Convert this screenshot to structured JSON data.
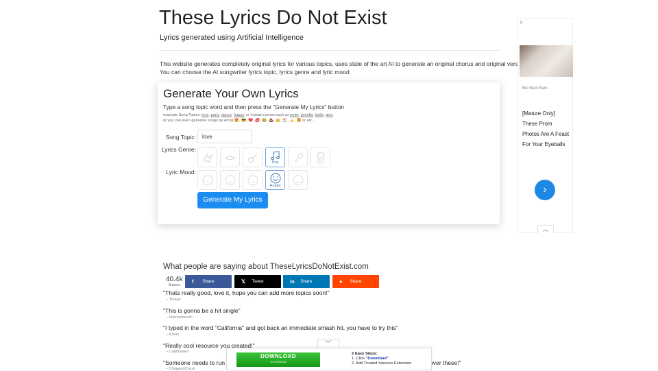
{
  "header": {
    "title": "These Lyrics Do Not Exist",
    "subtitle": "Lyrics generated using Artificial Intelligence"
  },
  "intro": {
    "line1": "This website generates completely original lyrics for various topics, uses state of the art AI to generate an original chorus and original verses",
    "line2": "You can choose the AI songwriter lyrics topic, lyrics genre and lyric mood"
  },
  "generator": {
    "title": "Generate Your Own Lyrics",
    "instruction": "Type a song topic word and then press the \"Generate My Lyrics\" button",
    "examples_prefix": "example Song Topics:",
    "example_topics": [
      "love",
      "party",
      "dance",
      "happy"
    ],
    "names_prefix": ", or human names such as",
    "example_names": [
      "peter",
      "jennifer",
      "bella",
      "alex"
    ],
    "emoji_prefix": "or you can even generate songs by emoji",
    "emojis": "🤩, 😎, ❤️, 💋, 😂, 💩, 👑, 🏖️, 🍌, 🍔",
    "emoji_suffix": "or etc...",
    "topic_label": "Song Topic:",
    "topic_value": "love",
    "genre_label": "Lyrics Genre:",
    "genres": [
      {
        "icon": "rock-icon",
        "label": "",
        "selected": false
      },
      {
        "icon": "country-icon",
        "label": "",
        "selected": false
      },
      {
        "icon": "guitar-icon",
        "label": "",
        "selected": false
      },
      {
        "icon": "music-note-icon",
        "label": "Pop",
        "selected": true
      },
      {
        "icon": "microphone-icon",
        "label": "",
        "selected": false
      },
      {
        "icon": "metal-icon",
        "label": "",
        "selected": false
      }
    ],
    "mood_label": "Lyric Mood:",
    "moods": [
      {
        "icon": "angry-face-icon",
        "label": "",
        "selected": false
      },
      {
        "icon": "sad-face-icon",
        "label": "",
        "selected": false
      },
      {
        "icon": "neutral-face-icon",
        "label": "",
        "selected": false
      },
      {
        "icon": "happy-face-icon",
        "label": "Happy",
        "selected": true
      },
      {
        "icon": "love-face-icon",
        "label": "",
        "selected": false
      }
    ],
    "button_label": "Generate My Lyrics"
  },
  "ad": {
    "source": "Bio Bam Bam",
    "lines": [
      "[Mature Only]",
      "These Prom",
      "Photos Are A Feast",
      "For Your Eyeballs"
    ]
  },
  "testimonials": {
    "title": "What people are saying about TheseLyricsDoNotExist.com",
    "share_count": "40.4k",
    "share_label": "Shares",
    "share_buttons": [
      {
        "name": "facebook",
        "icon": "f",
        "label": "Share",
        "color": "#3b5998"
      },
      {
        "name": "twitter",
        "icon": "𝕏",
        "label": "Tweet",
        "color": "#000000"
      },
      {
        "name": "linkedin",
        "icon": "in",
        "label": "Share",
        "color": "#0077b5"
      },
      {
        "name": "reddit",
        "icon": "●",
        "label": "Share",
        "color": "#ff4500"
      }
    ],
    "quotes": [
      {
        "text": "\"Thats really good, love it, hope you can add more topics soon!\"",
        "author": "– Thiago"
      },
      {
        "text": "\"This is gonna be a hit single\"",
        "author": "– Internetmoshi"
      },
      {
        "text": "\"I typed in the word \"California\" and got back an immediate smash hit, you have to try this\"",
        "author": "– Ethan"
      },
      {
        "text": "\"Really cool resource you created!\"",
        "author": "– CaliBrewed"
      },
      {
        "text": "\"Someone needs to run th",
        "text_end": "over these!\"",
        "author": "– ChoppedOnLol"
      }
    ]
  },
  "bottom_ad": {
    "button_main": "DOWNLOAD",
    "button_sub": "EXTENSION",
    "steps_title": "2 Easy Steps:",
    "step1_prefix": "1. Click ",
    "step1_bold": "\"Download\"",
    "step2": "2. Add Trusted Sources Extension"
  }
}
